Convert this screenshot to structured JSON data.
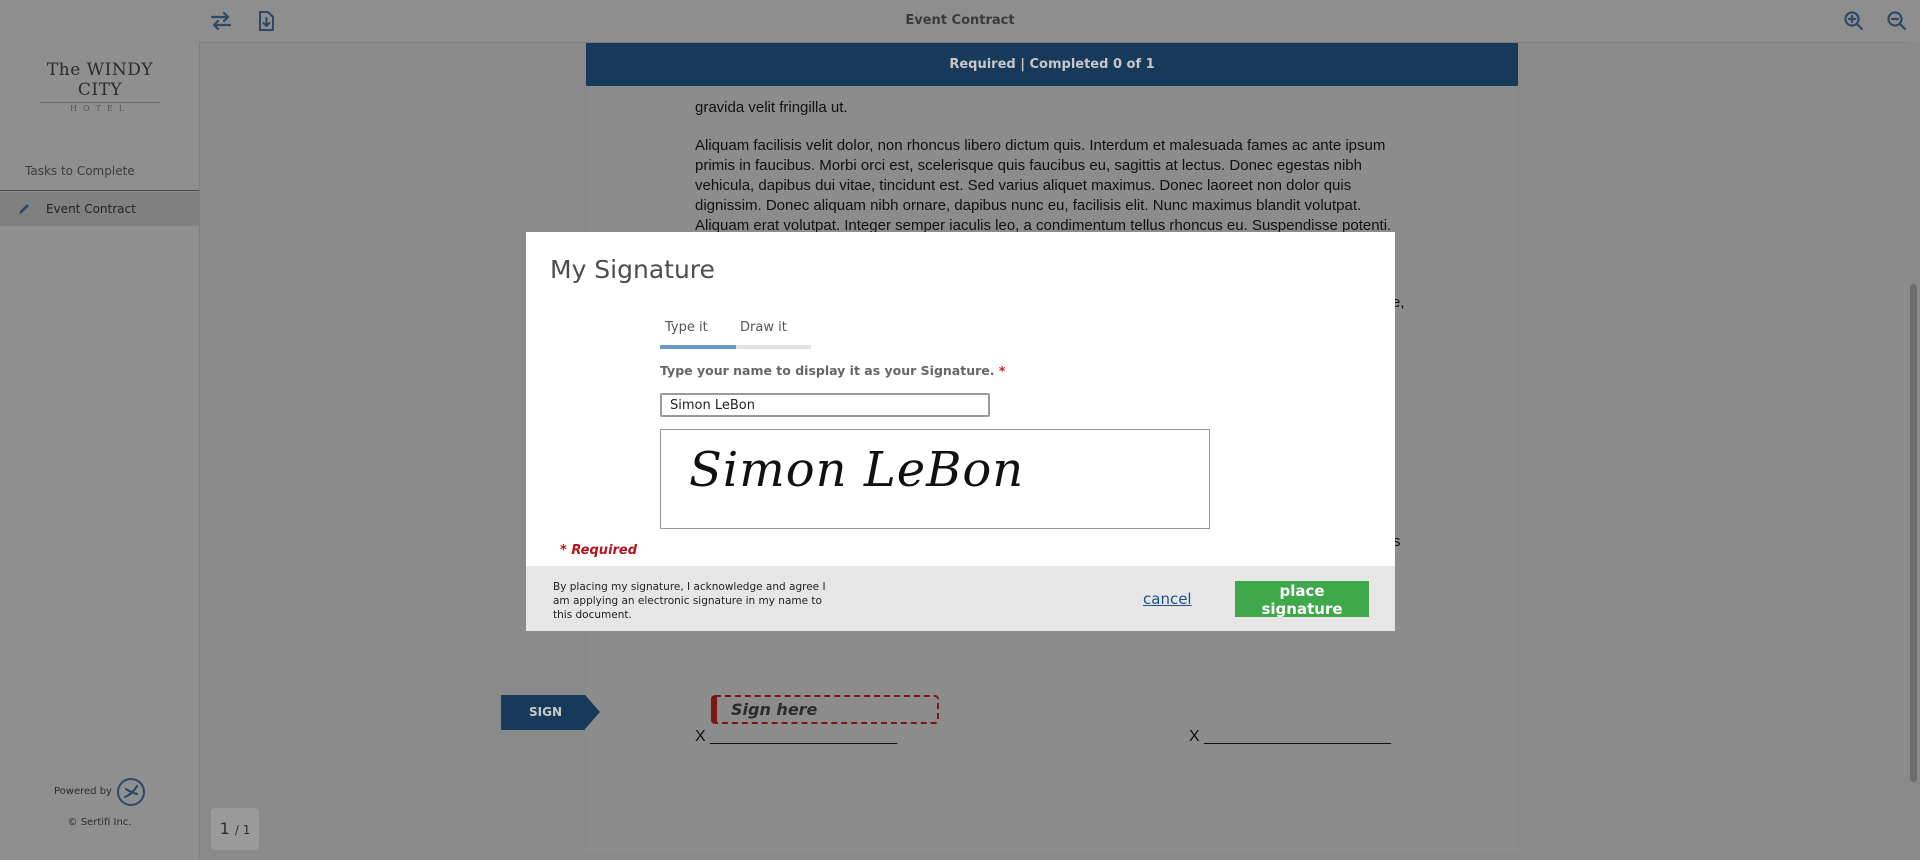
{
  "topbar": {
    "title": "Event Contract",
    "left_icons": [
      "swap-icon",
      "download-icon"
    ],
    "right_icons": [
      "zoom-in-icon",
      "zoom-out-icon"
    ]
  },
  "sidebar": {
    "logo_name": "The WINDY CITY",
    "logo_sub": "HOTEL",
    "tasks_label": "Tasks to Complete",
    "items": [
      {
        "label": "Event Contract",
        "icon": "pencil-icon"
      }
    ],
    "powered_by": "Powered by",
    "copyright": "© Sertifi Inc."
  },
  "page_counter": {
    "current": "1",
    "total": "/ 1"
  },
  "document": {
    "banner": "Required | Completed  0 of  1",
    "para_top": "gravida velit fringilla ut.",
    "para_main": "Aliquam facilisis velit dolor, non rhoncus libero dictum quis. Interdum et malesuada fames ac ante ipsum primis in faucibus. Morbi orci est, scelerisque quis faucibus eu, sagittis at lectus. Donec egestas nibh vehicula, dapibus dui vitae, tincidunt est. Sed varius aliquet maximus. Donec laoreet non dolor quis dignissim. Donec aliquam nibh ornare, dapibus nunc eu, facilisis elit. Nunc maximus blandit volutpat. Aliquam erat volutpat. Integer semper iaculis leo, a condimentum tellus rhoncus eu. Suspendisse potenti.",
    "right_fragment_1": "e,",
    "right_fragment_2": "s",
    "sign_tag": "SIGN",
    "sign_here": "Sign here",
    "sig_line_left": "X _____________________",
    "sig_line_right": "X _____________________"
  },
  "modal": {
    "title": "My Signature",
    "tabs": [
      {
        "label": "Type it",
        "active": true
      },
      {
        "label": "Draw it",
        "active": false
      }
    ],
    "field_label": "Type your name to display it as your Signature.",
    "required_star": "*",
    "name_value": "Simon LeBon",
    "signature_preview": "Simon LeBon",
    "required_note": "* Required",
    "acknowledgement": "By placing my signature, I acknowledge and agree I am applying an electronic signature in my name to this document.",
    "cancel_label": "cancel",
    "place_label": "place signature"
  },
  "colors": {
    "accent": "#17395a",
    "primary_button": "#3ea84a",
    "required_red": "#b4141a",
    "tab_active": "#6a9ac7",
    "link": "#1f4f86"
  }
}
